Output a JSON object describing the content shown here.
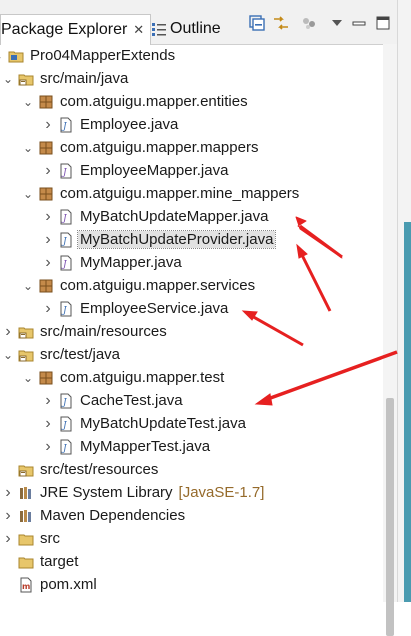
{
  "tabs": [
    {
      "label": "Package Explorer",
      "close": "✕"
    },
    {
      "label": "Outline"
    }
  ],
  "toolbar": {
    "icons": [
      "collapse-all-icon",
      "link-with-editor-icon",
      "filter-icon",
      "view-menu-icon",
      "minimize-icon",
      "maximize-icon"
    ]
  },
  "tree": [
    {
      "text": "Pro04MapperExtends",
      "depth": 0,
      "expanded": true,
      "icon": "project"
    },
    {
      "text": "src/main/java",
      "depth": 1,
      "expanded": true,
      "icon": "srcfolder"
    },
    {
      "text": "com.atguigu.mapper.entities",
      "depth": 2,
      "expanded": true,
      "icon": "package"
    },
    {
      "text": "Employee.java",
      "depth": 3,
      "expanded": false,
      "icon": "class"
    },
    {
      "text": "com.atguigu.mapper.mappers",
      "depth": 2,
      "expanded": true,
      "icon": "package"
    },
    {
      "text": "EmployeeMapper.java",
      "depth": 3,
      "expanded": false,
      "icon": "interface"
    },
    {
      "text": "com.atguigu.mapper.mine_mappers",
      "depth": 2,
      "expanded": true,
      "icon": "package"
    },
    {
      "text": "MyBatchUpdateMapper.java",
      "depth": 3,
      "expanded": false,
      "icon": "interface"
    },
    {
      "text": "MyBatchUpdateProvider.java",
      "depth": 3,
      "expanded": false,
      "icon": "class",
      "selected": true
    },
    {
      "text": "MyMapper.java",
      "depth": 3,
      "expanded": false,
      "icon": "interface"
    },
    {
      "text": "com.atguigu.mapper.services",
      "depth": 2,
      "expanded": true,
      "icon": "package"
    },
    {
      "text": "EmployeeService.java",
      "depth": 3,
      "expanded": false,
      "icon": "class"
    },
    {
      "text": "src/main/resources",
      "depth": 1,
      "expanded": false,
      "icon": "srcfolder"
    },
    {
      "text": "src/test/java",
      "depth": 1,
      "expanded": true,
      "icon": "srcfolder"
    },
    {
      "text": "com.atguigu.mapper.test",
      "depth": 2,
      "expanded": true,
      "icon": "package"
    },
    {
      "text": "CacheTest.java",
      "depth": 3,
      "expanded": false,
      "icon": "class"
    },
    {
      "text": "MyBatchUpdateTest.java",
      "depth": 3,
      "expanded": false,
      "icon": "class"
    },
    {
      "text": "MyMapperTest.java",
      "depth": 3,
      "expanded": false,
      "icon": "class"
    },
    {
      "text": "src/test/resources",
      "depth": 1,
      "expanded": null,
      "icon": "srcfolder"
    },
    {
      "text": "JRE System Library",
      "decoration": "[JavaSE-1.7]",
      "depth": 1,
      "expanded": false,
      "icon": "library"
    },
    {
      "text": "Maven Dependencies",
      "depth": 1,
      "expanded": false,
      "icon": "library"
    },
    {
      "text": "src",
      "depth": 1,
      "expanded": false,
      "icon": "folder"
    },
    {
      "text": "target",
      "depth": 1,
      "expanded": null,
      "icon": "folder"
    },
    {
      "text": "pom.xml",
      "depth": 1,
      "expanded": null,
      "icon": "xml"
    }
  ],
  "colors": {
    "annotation_arrow": "#e62020",
    "selection": "#e2e2e2",
    "package": "#a06a2c",
    "java_file": "#3c6fb4"
  }
}
